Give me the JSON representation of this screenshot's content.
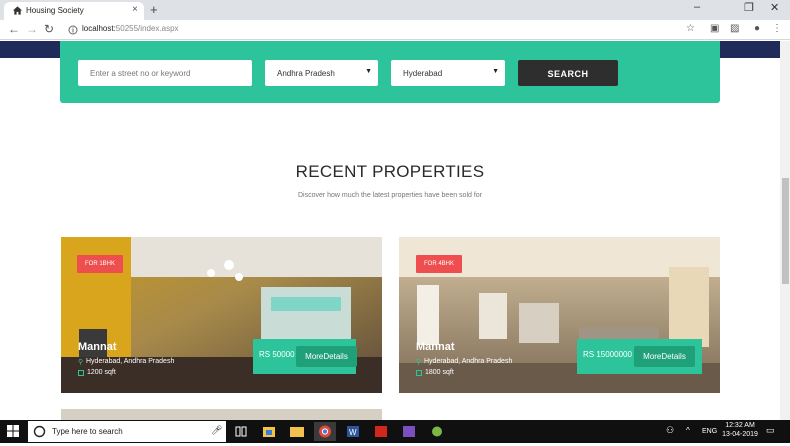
{
  "browser": {
    "tab_title": "Housing Society",
    "tab_close": "×",
    "new_tab": "+",
    "url_host": "localhost:",
    "url_rest": "50255/index.aspx",
    "window_controls": [
      "–",
      "❐",
      "✕"
    ]
  },
  "search": {
    "keyword_placeholder": "Enter a street no or keyword",
    "state_selected": "Andhra Pradesh",
    "city_selected": "Hyderabad",
    "button_label": "SEARCH"
  },
  "section": {
    "title": "RECENT PROPERTIES",
    "subtitle": "Discover how much the latest properties have been sold for"
  },
  "properties": [
    {
      "badge": "FOR 1BHK",
      "name": "Mannat",
      "location": "Hyderabad, Andhra Pradesh",
      "area": "1200 sqft",
      "price": "RS 50000",
      "more_label": "MoreDetails"
    },
    {
      "badge": "FOR 4BHK",
      "name": "Mannat",
      "location": "Hyderabad, Andhra Pradesh",
      "area": "1800 sqft",
      "price": "RS 15000000",
      "more_label": "MoreDetails"
    }
  ],
  "taskbar": {
    "search_placeholder": "Type here to search",
    "language": "ENG",
    "time": "12:32 AM",
    "date": "13-04-2019"
  },
  "colors": {
    "accent": "#2dc49b",
    "badge": "#ef4e4e",
    "dark_button": "#2e2e2e"
  }
}
